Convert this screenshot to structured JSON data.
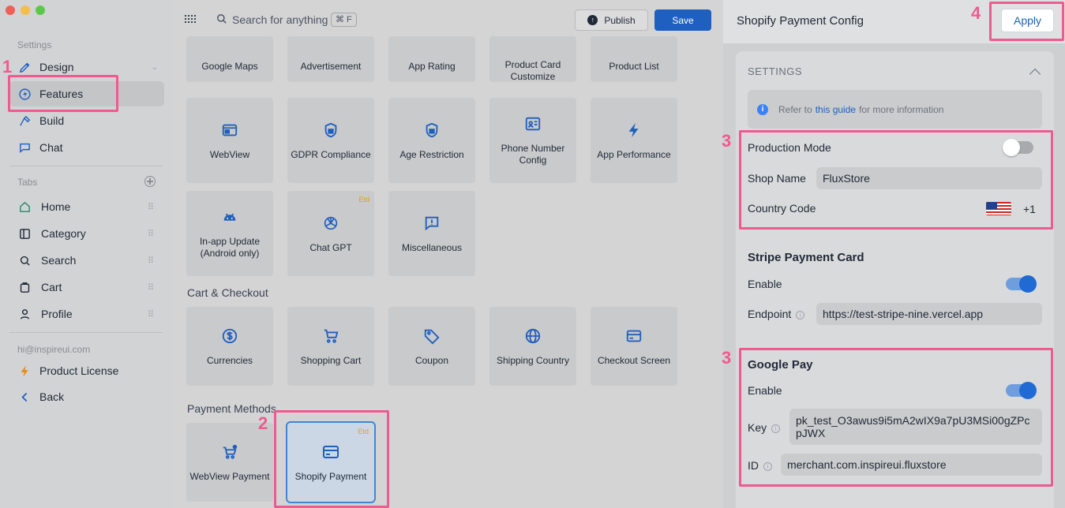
{
  "sidebar": {
    "settings_heading": "Settings",
    "settings_items": [
      {
        "label": "Design",
        "icon": "design-pen-icon"
      },
      {
        "label": "Features",
        "icon": "bolt-circle-icon"
      },
      {
        "label": "Build",
        "icon": "hammer-icon"
      },
      {
        "label": "Chat",
        "icon": "chat-icon"
      }
    ],
    "tabs_heading": "Tabs",
    "tabs": [
      {
        "label": "Home",
        "icon": "home-icon"
      },
      {
        "label": "Category",
        "icon": "category-icon"
      },
      {
        "label": "Search",
        "icon": "search-icon"
      },
      {
        "label": "Cart",
        "icon": "cart-icon"
      },
      {
        "label": "Profile",
        "icon": "profile-icon"
      }
    ],
    "account_email": "hi@inspireui.com",
    "license_label": "Product License",
    "back_label": "Back"
  },
  "topbar": {
    "search_placeholder": "Search for anything",
    "shortcut": "⌘ F",
    "publish_label": "Publish",
    "save_label": "Save"
  },
  "features": {
    "row1": [
      "Google Maps",
      "Advertisement",
      "App Rating",
      "Product Card Customize",
      "Product List"
    ],
    "row2": [
      "WebView",
      "GDPR Compliance",
      "Age Restriction",
      "Phone Number Config",
      "App Performance"
    ],
    "row3": [
      "In-app Update (Android only)",
      "Chat GPT",
      "Miscellaneous"
    ],
    "etd_badge": "Etd"
  },
  "cart_checkout": {
    "title": "Cart & Checkout",
    "items": [
      "Currencies",
      "Shopping Cart",
      "Coupon",
      "Shipping Country",
      "Checkout Screen"
    ]
  },
  "payment_methods": {
    "title": "Payment Methods",
    "items": [
      "WebView Payment",
      "Shopify Payment"
    ]
  },
  "annotations": [
    "1",
    "2",
    "3",
    "3",
    "4"
  ],
  "panel": {
    "title": "Shopify Payment Config",
    "apply_label": "Apply",
    "settings_label": "SETTINGS",
    "info_prefix": "Refer to",
    "info_link": "this guide",
    "info_suffix": "for more information",
    "production_mode_label": "Production Mode",
    "production_mode": false,
    "shop_name_label": "Shop Name",
    "shop_name": "FluxStore",
    "country_code_label": "Country Code",
    "country_dial": "+1",
    "stripe": {
      "title": "Stripe Payment Card",
      "enable_label": "Enable",
      "enabled": true,
      "endpoint_label": "Endpoint",
      "endpoint": "https://test-stripe-nine.vercel.app"
    },
    "google_pay": {
      "title": "Google Pay",
      "enable_label": "Enable",
      "enabled": true,
      "key_label": "Key",
      "key": "pk_test_O3awus9i5mA2wIX9a7pU3MSi00gZPcpJWX",
      "id_label": "ID",
      "id": "merchant.com.inspireui.fluxstore"
    }
  },
  "colors": {
    "accent_blue": "#1f5fbf",
    "highlight_pink": "#ef5a8f",
    "etd_orange": "#e49b16"
  }
}
